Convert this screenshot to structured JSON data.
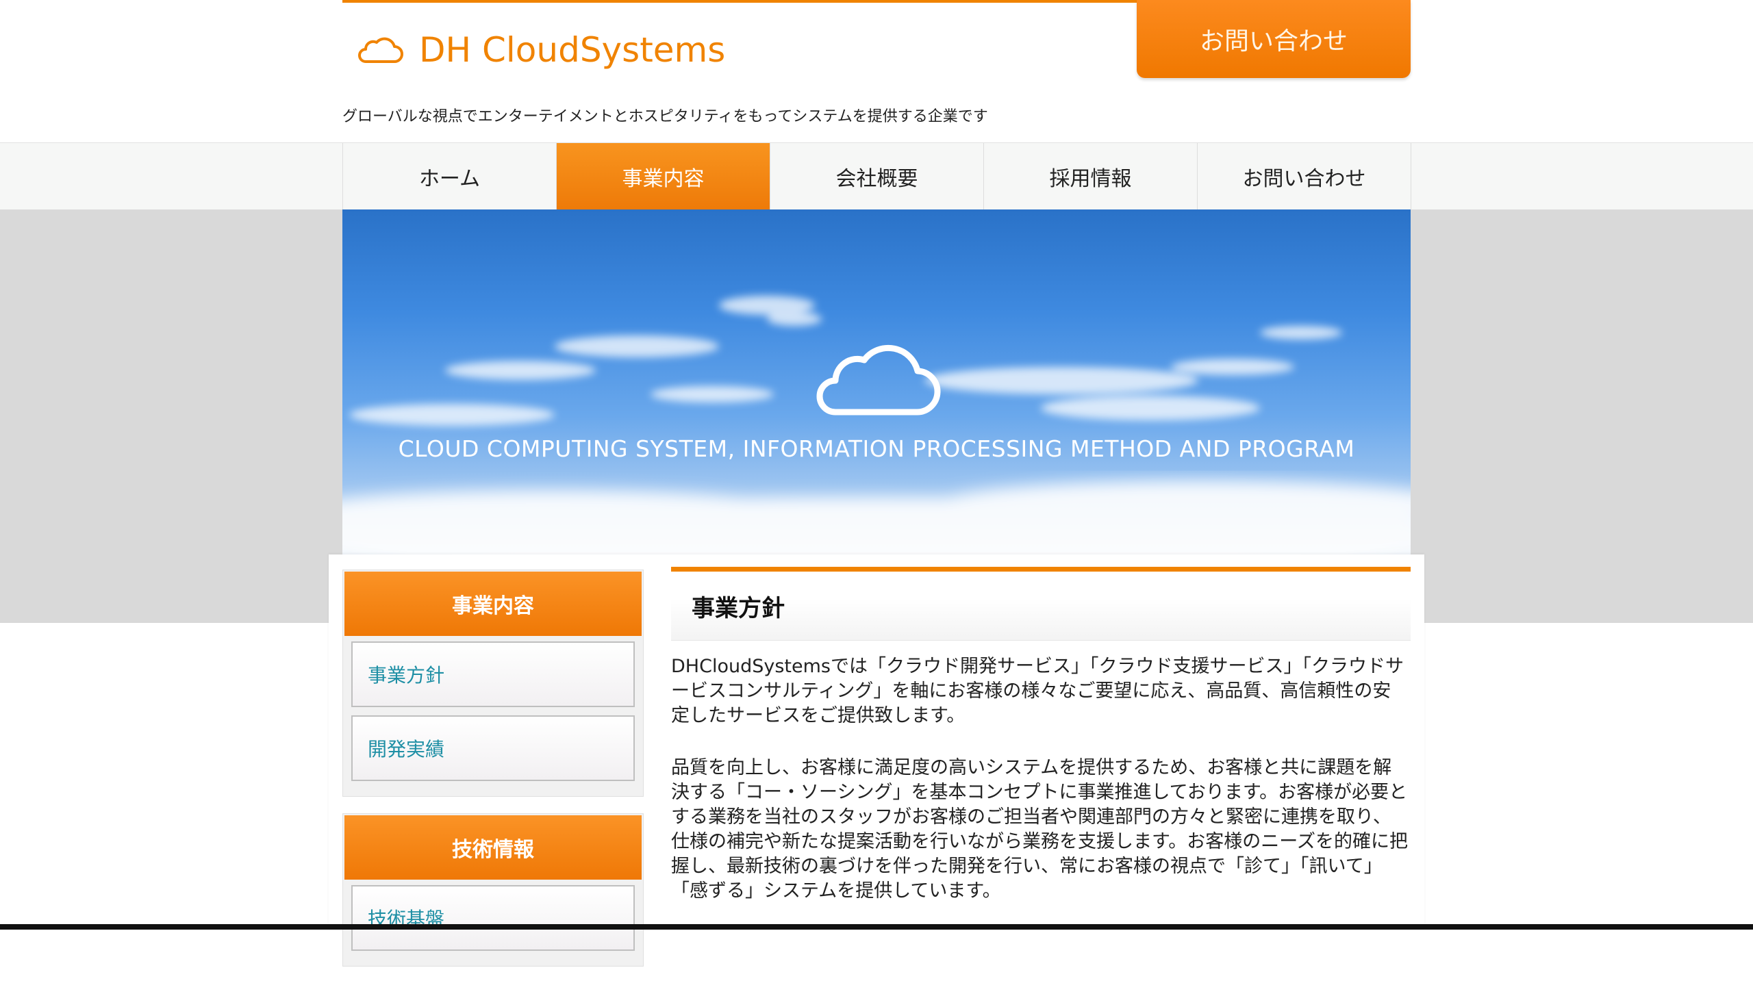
{
  "header": {
    "logo_text": "DH CloudSystems",
    "tagline": "グローバルな視点でエンターテイメントとホスピタリティをもってシステムを提供する企業です",
    "contact_button": "お問い合わせ"
  },
  "nav": {
    "items": [
      {
        "label": "ホーム"
      },
      {
        "label": "事業内容"
      },
      {
        "label": "会社概要"
      },
      {
        "label": "採用情報"
      },
      {
        "label": "お問い合わせ"
      }
    ],
    "active": "事業内容"
  },
  "hero": {
    "caption": "CLOUD COMPUTING SYSTEM, INFORMATION PROCESSING METHOD AND PROGRAM"
  },
  "sidebar": {
    "sections": [
      {
        "title": "事業内容",
        "links": [
          {
            "label": "事業方針"
          },
          {
            "label": "開発実績"
          }
        ]
      },
      {
        "title": "技術情報",
        "links": [
          {
            "label": "技術基盤"
          }
        ]
      }
    ]
  },
  "main": {
    "heading": "事業方針",
    "paragraphs": [
      "DHCloudSystemsでは「クラウド開発サービス」「クラウド支援サービス」「クラウドサービスコンサルティング」を軸にお客様の様々なご要望に応え、高品質、高信頼性の安定したサービスをご提供致します。",
      "品質を向上し、お客様に満足度の高いシステムを提供するため、お客様と共に課題を解決する「コー・ソーシング」を基本コンセプトに事業推進しております。お客様が必要とする業務を当社のスタッフがお客様のご担当者や関連部門の方々と緊密に連携を取り、仕様の補完や新たな提案活動を行いながら業務を支援します。お客様のニーズを的確に把握し、最新技術の裏づけを伴った開発を行い、常にお客様の視点で「診て」「訊いて」「感ずる」システムを提供しています。"
    ]
  },
  "colors": {
    "accent": "#f08300",
    "link": "#1e8fa5",
    "band_gray": "#d9d9d9"
  },
  "icons": {
    "logo": "cloud-outline-icon",
    "hero": "cloud-outline-icon"
  }
}
